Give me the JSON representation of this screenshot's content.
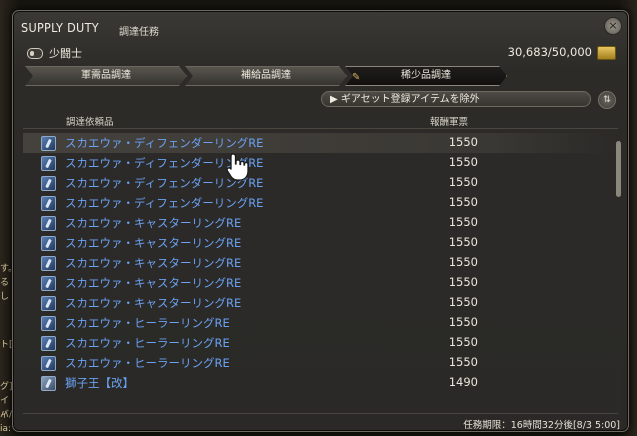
{
  "window": {
    "title_en": "SUPPLY DUTY",
    "title_jp": "調達任務",
    "close_icon": "×"
  },
  "job": {
    "name": "少闘士"
  },
  "seals": {
    "text": "30,683/50,000"
  },
  "tabs": [
    {
      "label": "軍需品調達",
      "active": false
    },
    {
      "label": "補給品調達",
      "active": false
    },
    {
      "label": "稀少品調達",
      "active": true
    }
  ],
  "filter": {
    "label": "▶ ギアセット登録アイテムを除外"
  },
  "sort_icon": "⇅",
  "columns": {
    "item": "調達依頼品",
    "reward": "報酬軍票"
  },
  "items": [
    {
      "name": "スカエウァ・ディフェンダーリングRE",
      "reward": "1550"
    },
    {
      "name": "スカエウァ・ディフェンダーリングRE",
      "reward": "1550"
    },
    {
      "name": "スカエウァ・ディフェンダーリングRE",
      "reward": "1550"
    },
    {
      "name": "スカエウァ・ディフェンダーリングRE",
      "reward": "1550"
    },
    {
      "name": "スカエウァ・キャスターリングRE",
      "reward": "1550"
    },
    {
      "name": "スカエウァ・キャスターリングRE",
      "reward": "1550"
    },
    {
      "name": "スカエウァ・キャスターリングRE",
      "reward": "1550"
    },
    {
      "name": "スカエウァ・キャスターリングRE",
      "reward": "1550"
    },
    {
      "name": "スカエウァ・キャスターリングRE",
      "reward": "1550"
    },
    {
      "name": "スカエウァ・ヒーラーリングRE",
      "reward": "1550"
    },
    {
      "name": "スカエウァ・ヒーラーリングRE",
      "reward": "1550"
    },
    {
      "name": "スカエウァ・ヒーラーリングRE",
      "reward": "1550"
    },
    {
      "name": "獅子王【改】",
      "reward": "1490"
    }
  ],
  "deadline": "任務期限：16時間32分後[8/3 5:00]",
  "side_fragments": [
    "す。",
    "るし",
    "ト[",
    "グ]",
    "イバ",
    "ィ/2",
    "ia:"
  ],
  "colors": {
    "item_link": "#6aa1f2",
    "seal": "#d8b040"
  },
  "icons": {
    "item": "ring-icon",
    "job": "job-icon",
    "seal": "company-seal-icon",
    "cursor": "hand-cursor-icon"
  }
}
